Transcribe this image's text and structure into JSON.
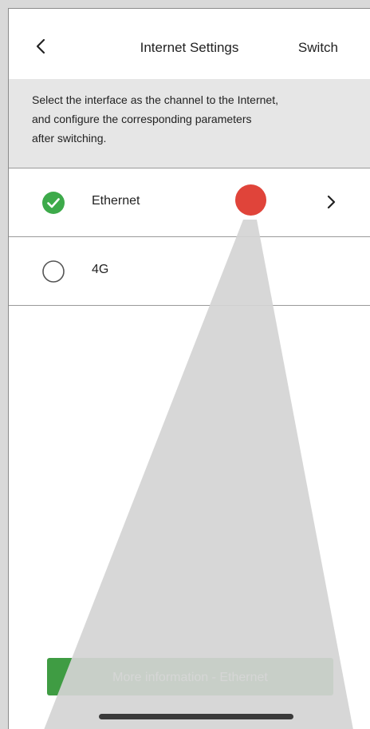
{
  "nav": {
    "title": "Internet Settings",
    "switch_label": "Switch",
    "back_icon": "chevron-left-icon"
  },
  "description": {
    "line1": "Select the interface as the channel to the Internet,",
    "line2": "and configure the corresponding parameters",
    "line3": "after switching."
  },
  "options": [
    {
      "label": "Ethernet",
      "selected": true,
      "icon": "check-circle-icon",
      "has_chevron": true
    },
    {
      "label": "4G",
      "selected": false,
      "icon": "radio-empty-icon",
      "has_chevron": false
    }
  ],
  "more_button": {
    "label": "More information - Ethernet"
  },
  "colors": {
    "accent_green": "#3f9c43",
    "check_green": "#3daa4a",
    "marker_red": "#e0443a",
    "description_bg": "#e6e6e6"
  }
}
